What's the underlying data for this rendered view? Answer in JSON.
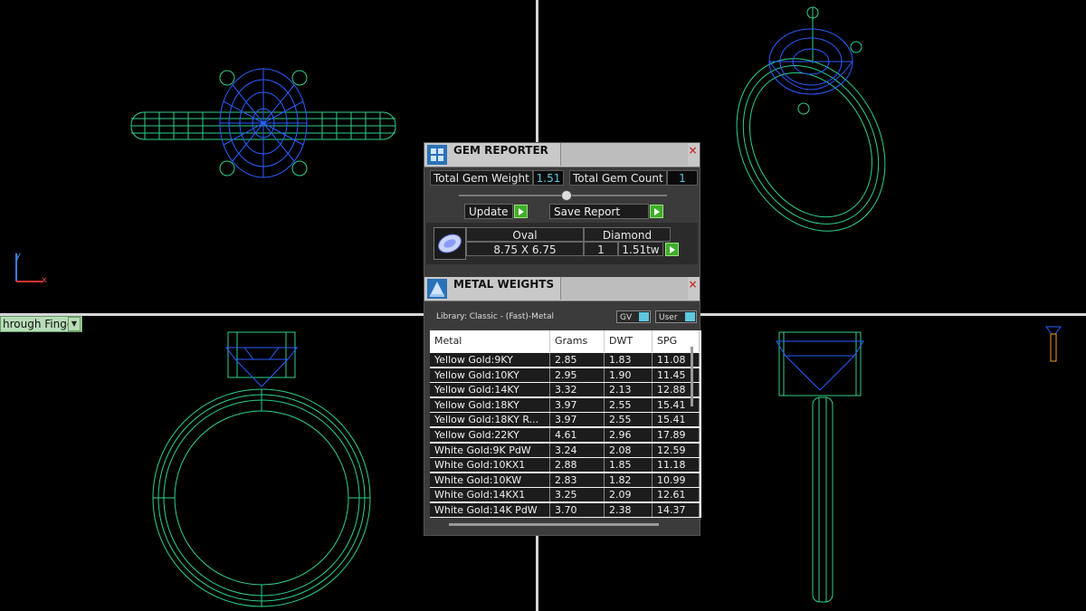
{
  "viewports": {
    "bottom_left_label": "hrough Finger"
  },
  "axes": {
    "x": "x",
    "y": "y"
  },
  "gem_reporter": {
    "title": "GEM REPORTER",
    "total_weight_label": "Total Gem Weight",
    "total_weight_value": "1.51",
    "total_count_label": "Total Gem Count",
    "total_count_value": "1",
    "update_label": "Update",
    "save_report_label": "Save Report",
    "gem": {
      "shape": "Oval",
      "size": "8.75 X 6.75",
      "material": "Diamond",
      "count": "1",
      "weight": "1.51tw"
    }
  },
  "metal_weights": {
    "title": "METAL WEIGHTS",
    "library": "Library: Classic - (Fast)-Metal",
    "gv_label": "GV",
    "user_label": "User",
    "columns": [
      "Metal",
      "Grams",
      "DWT",
      "SPG"
    ],
    "rows": [
      [
        "Yellow Gold:9KY",
        "2.85",
        "1.83",
        "11.08"
      ],
      [
        "Yellow Gold:10KY",
        "2.95",
        "1.90",
        "11.45"
      ],
      [
        "Yellow Gold:14KY",
        "3.32",
        "2.13",
        "12.88"
      ],
      [
        "Yellow Gold:18KY",
        "3.97",
        "2.55",
        "15.41"
      ],
      [
        "Yellow Gold:18KY R...",
        "3.97",
        "2.55",
        "15.41"
      ],
      [
        "Yellow Gold:22KY",
        "4.61",
        "2.96",
        "17.89"
      ],
      [
        "White Gold:9K PdW",
        "3.24",
        "2.08",
        "12.59"
      ],
      [
        "White Gold:10KX1",
        "2.88",
        "1.85",
        "11.18"
      ],
      [
        "White Gold:10KW",
        "2.83",
        "1.82",
        "10.99"
      ],
      [
        "White Gold:14KX1",
        "3.25",
        "2.09",
        "12.61"
      ],
      [
        "White Gold:14K PdW",
        "3.70",
        "2.38",
        "14.37"
      ]
    ]
  },
  "colors": {
    "wire_green": "#2fd08a",
    "wire_blue": "#2a5dff",
    "accent_cyan": "#5ec8e0",
    "go_green": "#3fae2a"
  }
}
